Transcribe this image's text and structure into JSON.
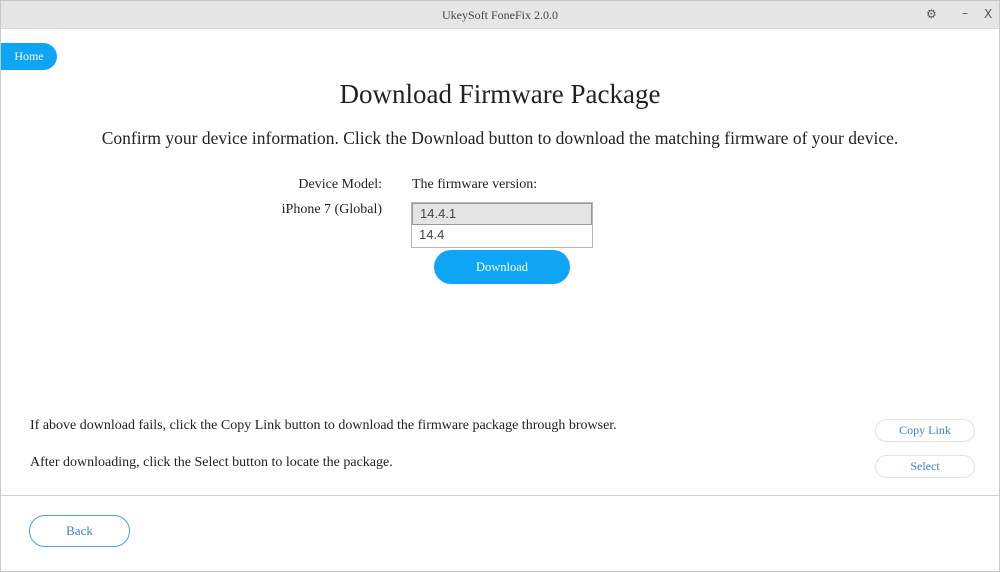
{
  "window": {
    "title": "UkeySoft FoneFix 2.0.0",
    "controls": {
      "settings_icon": "⚙",
      "minimize_icon": "–",
      "close_icon": "X"
    }
  },
  "nav": {
    "home_label": "Home"
  },
  "main": {
    "title": "Download Firmware Package",
    "subtitle": "Confirm your device information. Click the Download button to download the matching firmware of your device.",
    "device_model_label": "Device Model:",
    "device_model_value": "iPhone 7 (Global)",
    "firmware_label": "The firmware version:",
    "firmware_versions": [
      {
        "label": "14.4.1",
        "selected": true
      },
      {
        "label": "14.4",
        "selected": false
      }
    ],
    "download_label": "Download"
  },
  "hints": {
    "copy_link_hint": "If above download fails, click the Copy Link button to download the firmware package through browser.",
    "select_hint": "After downloading, click the Select button to locate the package.",
    "copy_link_label": "Copy Link",
    "select_label": "Select"
  },
  "footer": {
    "back_label": "Back"
  },
  "colors": {
    "accent": "#0ea5f5",
    "link_text": "#3a7fd0",
    "titlebar_bg": "#e6e6e6"
  }
}
